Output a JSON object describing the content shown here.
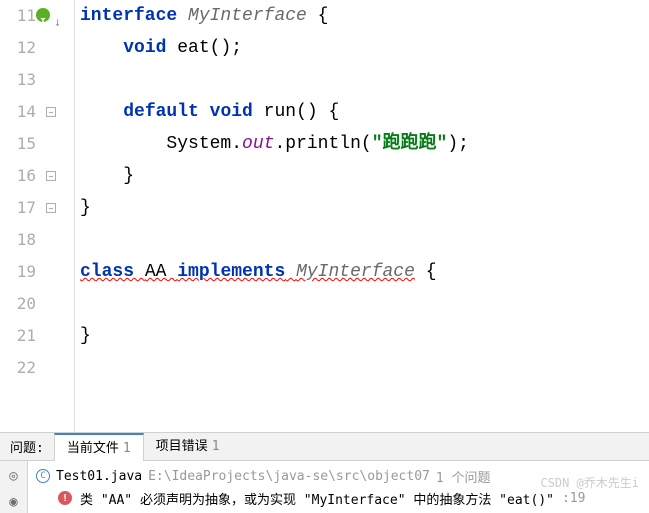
{
  "lines": {
    "11": 11,
    "12": 12,
    "13": 13,
    "14": 14,
    "15": 15,
    "16": 16,
    "17": 17,
    "18": 18,
    "19": 19,
    "20": 20,
    "21": 21,
    "22": 22
  },
  "code": {
    "kw_interface": "interface ",
    "iface_name": "MyInterface",
    "brace_o": " {",
    "kw_void1": "void ",
    "m_eat": "eat",
    "eat_tail": "();",
    "kw_default": "default ",
    "kw_void2": "void ",
    "m_run": "run",
    "run_tail": "() {",
    "sys": "System",
    "dot1": ".",
    "out": "out",
    "dot2": ".",
    "println": "println",
    "paren_o": "(",
    "str": "\"跑跑跑\"",
    "paren_c": ");",
    "brace_c1": "}",
    "brace_c2": "}",
    "kw_class": "class ",
    "cls_name": "AA",
    "sp1": " ",
    "kw_impl": "implements",
    "sp2": " ",
    "iface_ref": "MyInterface",
    "brace_o2": " {",
    "brace_c3": "}"
  },
  "panel": {
    "problems_label": "问题:",
    "tab_current": "当前文件",
    "tab_current_count": "1",
    "tab_project": "项目错误",
    "tab_project_count": "1",
    "file_name": "Test01.java",
    "file_path": "E:\\IdeaProjects\\java-se\\src\\object07",
    "file_count": "1 个问题",
    "error_msg": "类 \"AA\" 必须声明为抽象，或为实现 \"MyInterface\" 中的抽象方法 \"eat()\"",
    "error_loc": ":19"
  },
  "watermark": "CSDN @乔木先生i"
}
